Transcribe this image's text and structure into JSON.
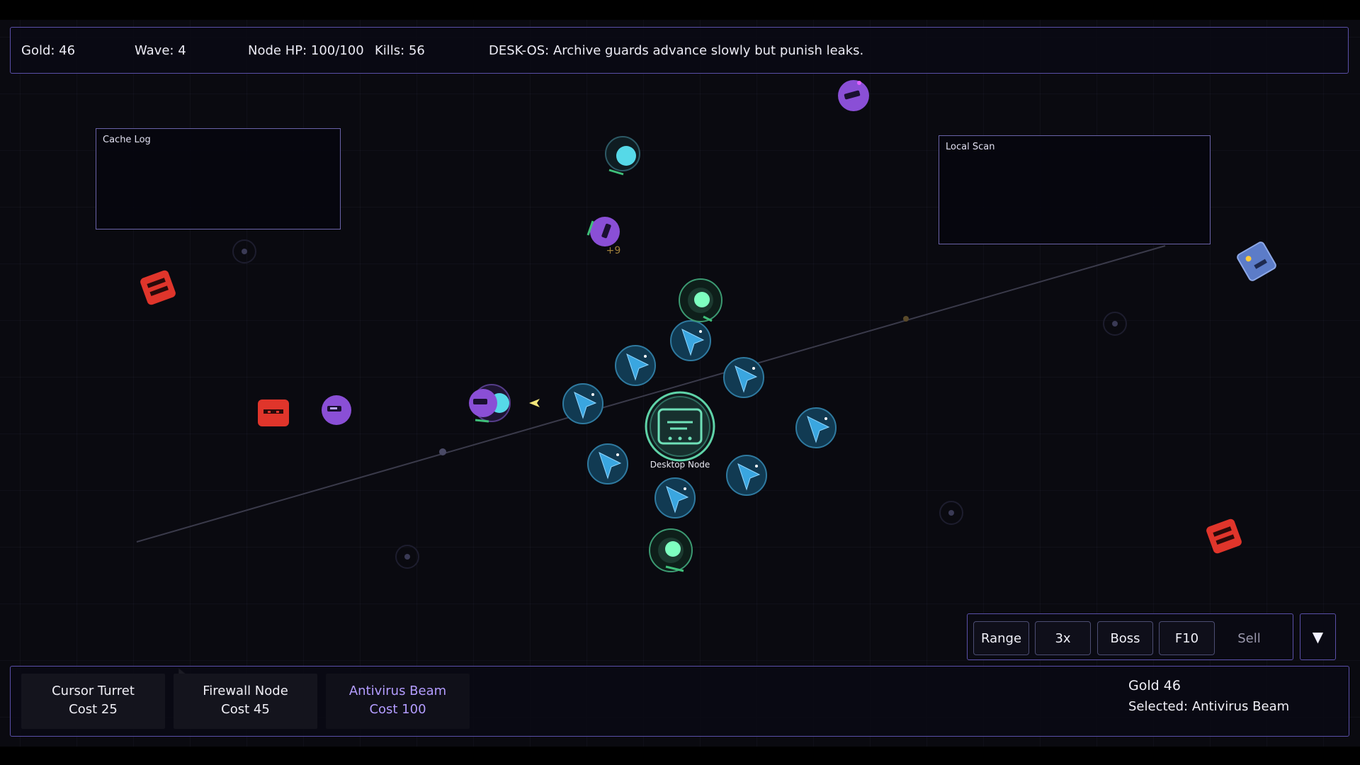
{
  "hud": {
    "gold": "Gold: 46",
    "wave": "Wave: 4",
    "node_hp": "Node HP: 100/100",
    "kills": "Kills: 56",
    "message": "DESK-OS: Archive guards advance slowly but punish leaks."
  },
  "panels": {
    "cache_log": "Cache Log",
    "local_scan": "Local Scan"
  },
  "core": {
    "label": "Desktop Node"
  },
  "floating_text": "+9",
  "controls": {
    "range": "Range",
    "speed": "3x",
    "boss": "Boss",
    "f10": "F10",
    "sell": "Sell",
    "collapse": "▼"
  },
  "shop": [
    {
      "name": "Cursor Turret",
      "cost": "Cost 25"
    },
    {
      "name": "Firewall Node",
      "cost": "Cost 45"
    },
    {
      "name": "Antivirus Beam",
      "cost": "Cost 100"
    }
  ],
  "status": {
    "gold": "Gold 46",
    "selected": "Selected: Antivirus Beam"
  },
  "colors": {
    "accent": "#5a4fa8",
    "core": "#5fd3a8",
    "cursor_turret": "#3a9ad6",
    "enemy_red": "#e0352b",
    "enemy_purple": "#8a4fd6",
    "beam": "#56d9e8"
  },
  "icons": {
    "cursor_turret": "cursor-arrow-icon",
    "firewall_node": "green-orb-icon",
    "antivirus_beam": "cyan-orb-icon",
    "core": "desktop-node-icon"
  }
}
